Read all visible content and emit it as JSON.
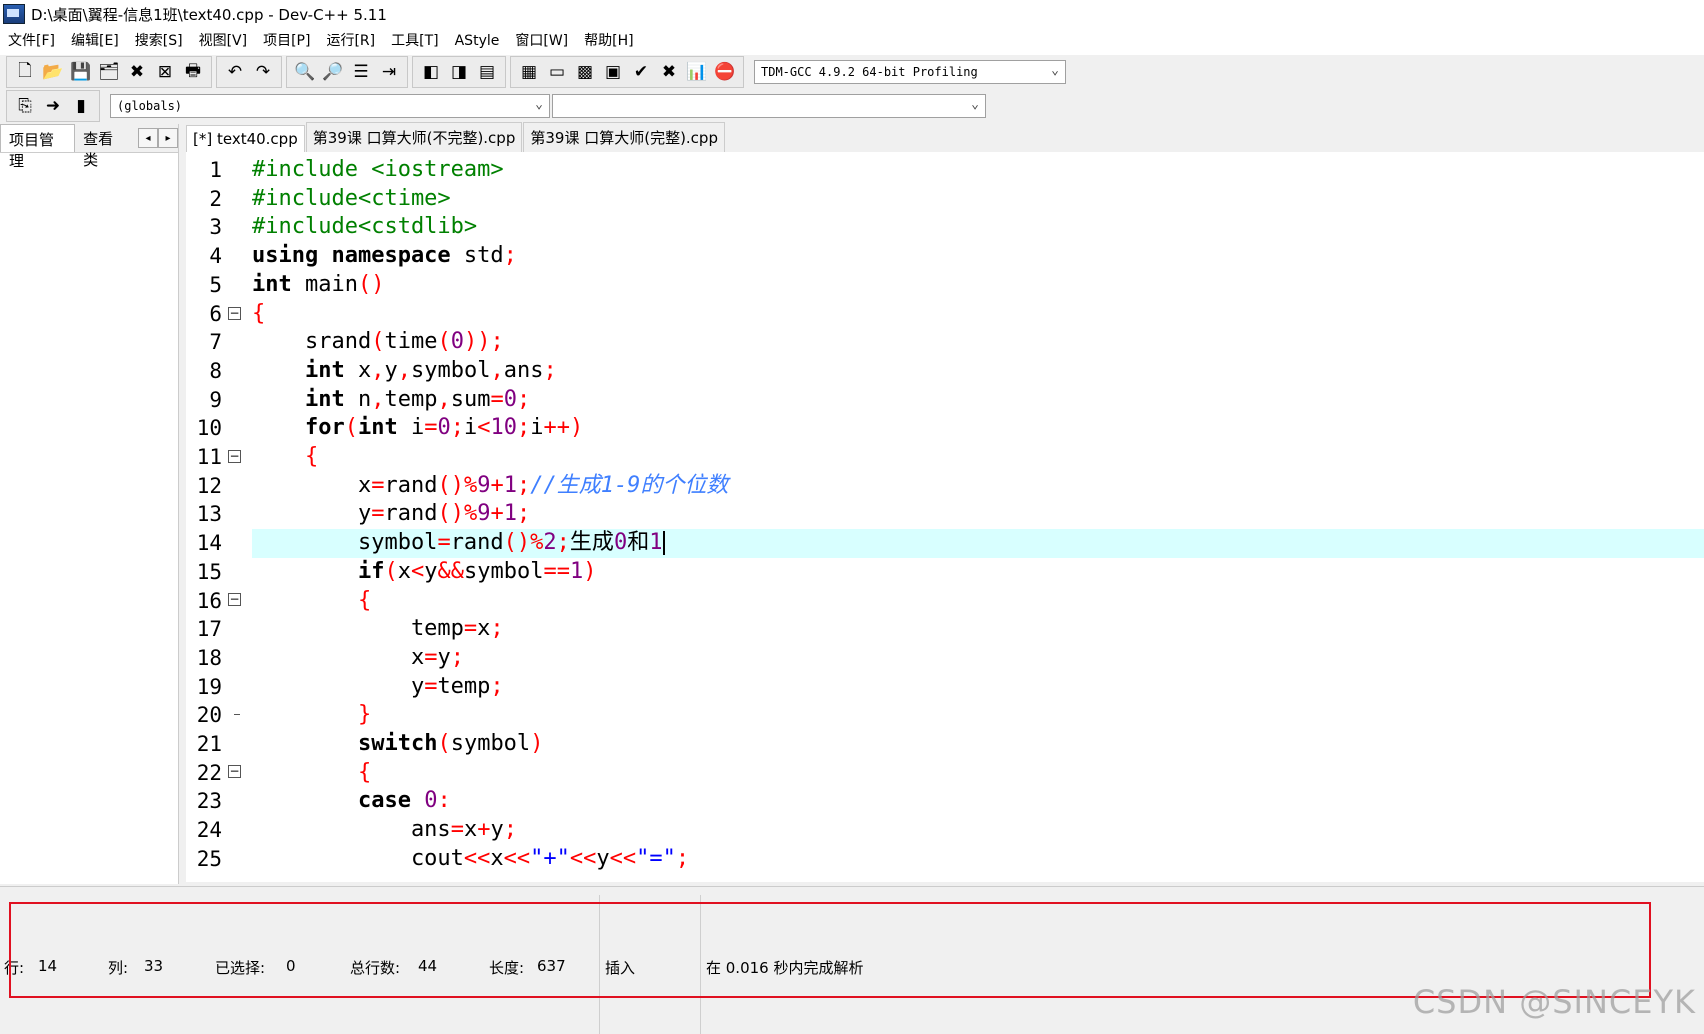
{
  "window": {
    "title": "D:\\桌面\\翼程-信息1班\\text40.cpp - Dev-C++ 5.11"
  },
  "menu": [
    "文件[F]",
    "编辑[E]",
    "搜索[S]",
    "视图[V]",
    "项目[P]",
    "运行[R]",
    "工具[T]",
    "AStyle",
    "窗口[W]",
    "帮助[H]"
  ],
  "toolbar": {
    "compiler": "TDM-GCC 4.9.2 64-bit Profiling",
    "scope": "(globals)",
    "function": ""
  },
  "left_panel": {
    "tabs": [
      "项目管理",
      "查看类"
    ]
  },
  "editor_tabs": [
    "[*] text40.cpp",
    "第39课 口算大师(不完整).cpp",
    "第39课 口算大师(完整).cpp"
  ],
  "code": {
    "line_numbers": [
      "1",
      "2",
      "3",
      "4",
      "5",
      "6",
      "7",
      "8",
      "9",
      "10",
      "11",
      "12",
      "13",
      "14",
      "15",
      "16",
      "17",
      "18",
      "19",
      "20",
      "21",
      "22",
      "23",
      "24",
      "25"
    ],
    "highlighted_line": 14
  },
  "status": {
    "row_label": "行:",
    "row": "14",
    "col_label": "列:",
    "col": "33",
    "sel_label": "已选择:",
    "sel": "0",
    "total_label": "总行数:",
    "total": "44",
    "len_label": "长度:",
    "len": "637",
    "mode": "插入",
    "parse": "在 0.016 秒内完成解析"
  },
  "watermark": "CSDN @SINCEYK"
}
